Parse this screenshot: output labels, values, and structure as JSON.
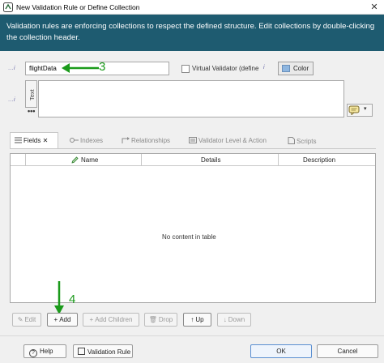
{
  "window": {
    "title": "New Validation Rule or Define Collection",
    "close_glyph": "✕"
  },
  "banner": {
    "text": "Validation rules are enforcing collections to respect the defined structure. Edit collections by double-clicking the collection header."
  },
  "name_row": {
    "info_icon": "info-icon",
    "info_glyph": "…i",
    "name_value": "flightData",
    "virtual_validator_label": "Virtual Validator (define",
    "virtual_validator_checked": false,
    "color_label": "Color",
    "color_value": "#8eb6e0"
  },
  "annotations": {
    "callout_3": "3",
    "callout_4": "4",
    "color": "#1a9a1a"
  },
  "text_area": {
    "side_tab_label": "Text",
    "dots": "•••",
    "value": "",
    "dropdown_glyph": "▾"
  },
  "tabs": [
    {
      "label": "Fields ✕",
      "active": true
    },
    {
      "label": "Indexes",
      "active": false
    },
    {
      "label": "Relationships",
      "active": false
    },
    {
      "label": "Validator Level & Action",
      "active": false
    },
    {
      "label": "Scripts",
      "active": false
    }
  ],
  "table": {
    "columns": [
      "Name",
      "Details",
      "Description"
    ],
    "rows": [],
    "empty_text": "No content in table"
  },
  "actions": {
    "edit": "Edit",
    "add": "Add",
    "add_children": "Add Children",
    "drop": "Drop",
    "up": "Up",
    "down": "Down"
  },
  "footer": {
    "help": "Help",
    "validation_rule": "Validation Rule",
    "ok": "OK",
    "cancel": "Cancel"
  }
}
